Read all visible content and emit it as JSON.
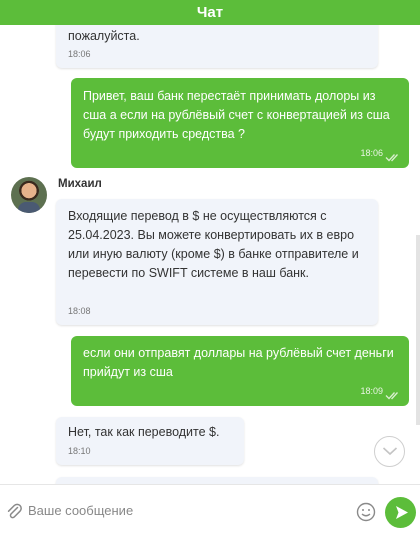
{
  "header": {
    "title": "Чат"
  },
  "messages": [
    {
      "text": "пожалуйста.",
      "time": "18:06"
    },
    {
      "text": "Привет, ваш банк перестаёт принимать долоры из сша а если на рублёвый счет с конвертацией из сша будут приходить средства ?",
      "time": "18:06"
    },
    {
      "sender": "Михаил",
      "text": "Входящие перевод в $ не осуществляются с 25.04.2023. Вы можете конвертировать их в евро или иную валюту (кроме $) в банке отправителе и перевести по SWIFT системе в наш банк.",
      "time": "18:08"
    },
    {
      "text": "если они отправят доллары на рублёвый счет деньги прийдут из сша",
      "time": "18:09"
    },
    {
      "text": "Нет, так как переводите $.",
      "time": "18:10"
    }
  ],
  "composer": {
    "placeholder": "Ваше сообщение"
  },
  "icons": [
    "double-check-icon",
    "chevron-down-icon",
    "paperclip-icon",
    "smile-icon",
    "send-icon"
  ],
  "colors": {
    "accent": "#5cbd3a",
    "incoming_bubble": "#f1f4fa"
  }
}
